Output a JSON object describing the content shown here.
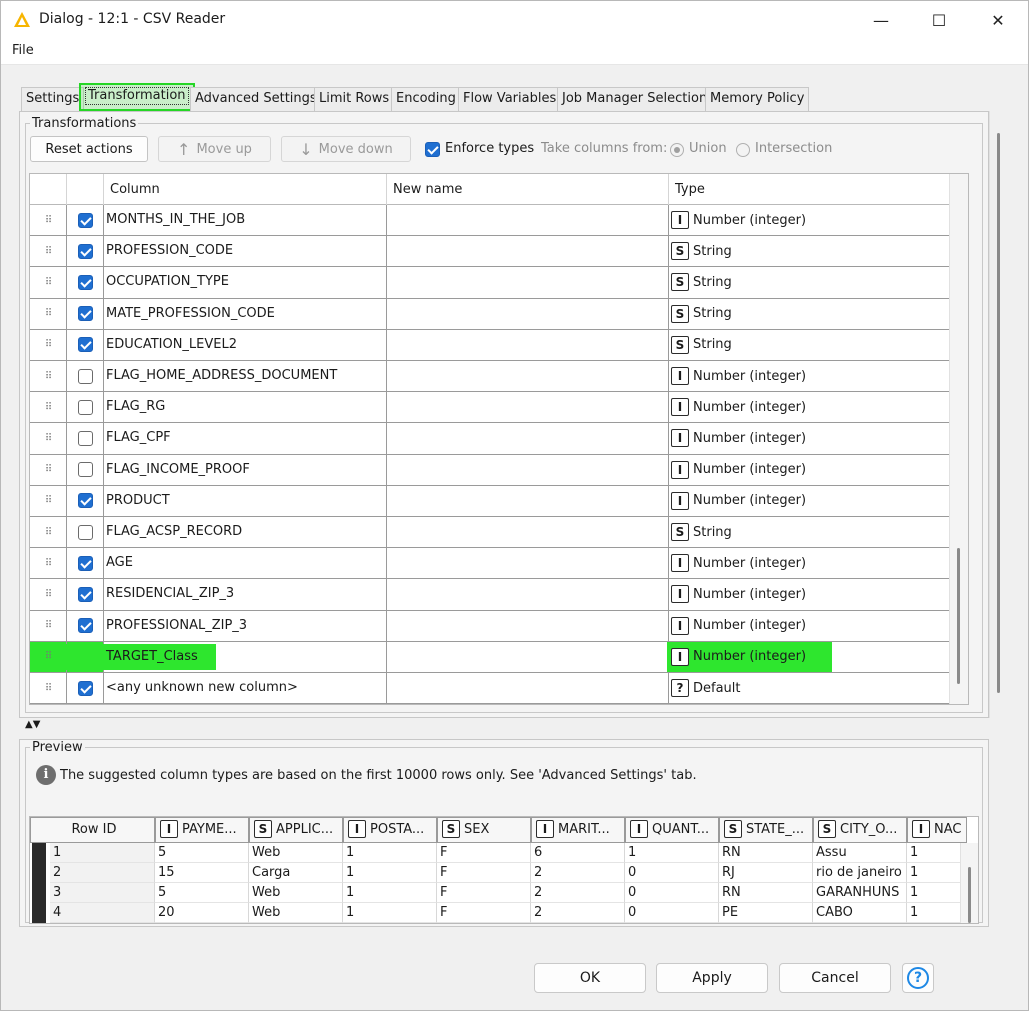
{
  "window": {
    "title": "Dialog - 12:1 - CSV Reader",
    "minimize_glyph": "—",
    "maximize_glyph": "☐",
    "close_glyph": "✕"
  },
  "menu": {
    "file": "File"
  },
  "tabs": [
    {
      "label": "Settings",
      "active": false
    },
    {
      "label": "Transformation",
      "active": true
    },
    {
      "label": "Advanced Settings",
      "active": false
    },
    {
      "label": "Limit Rows",
      "active": false
    },
    {
      "label": "Encoding",
      "active": false
    },
    {
      "label": "Flow Variables",
      "active": false
    },
    {
      "label": "Job Manager Selection",
      "active": false
    },
    {
      "label": "Memory Policy",
      "active": false
    }
  ],
  "transformations": {
    "group_title": "Transformations",
    "reset_label": "Reset actions",
    "move_up_label": "Move up",
    "move_down_label": "Move down",
    "enforce_types_label": "Enforce types",
    "enforce_types_checked": true,
    "take_columns_label": "Take columns from:",
    "union_label": "Union",
    "intersection_label": "Intersection",
    "selected_source": "Union",
    "headers": {
      "column": "Column",
      "new_name": "New name",
      "type": "Type"
    },
    "rows": [
      {
        "checked": true,
        "column": "MONTHS_IN_THE_JOB",
        "new_name": "",
        "type_icon": "I",
        "type": "Number (integer)"
      },
      {
        "checked": true,
        "column": "PROFESSION_CODE",
        "new_name": "",
        "type_icon": "S",
        "type": "String"
      },
      {
        "checked": true,
        "column": "OCCUPATION_TYPE",
        "new_name": "",
        "type_icon": "S",
        "type": "String"
      },
      {
        "checked": true,
        "column": "MATE_PROFESSION_CODE",
        "new_name": "",
        "type_icon": "S",
        "type": "String"
      },
      {
        "checked": true,
        "column": "EDUCATION_LEVEL2",
        "new_name": "",
        "type_icon": "S",
        "type": "String"
      },
      {
        "checked": false,
        "column": "FLAG_HOME_ADDRESS_DOCUMENT",
        "new_name": "",
        "type_icon": "I",
        "type": "Number (integer)"
      },
      {
        "checked": false,
        "column": "FLAG_RG",
        "new_name": "",
        "type_icon": "I",
        "type": "Number (integer)"
      },
      {
        "checked": false,
        "column": "FLAG_CPF",
        "new_name": "",
        "type_icon": "I",
        "type": "Number (integer)"
      },
      {
        "checked": false,
        "column": "FLAG_INCOME_PROOF",
        "new_name": "",
        "type_icon": "I",
        "type": "Number (integer)"
      },
      {
        "checked": true,
        "column": "PRODUCT",
        "new_name": "",
        "type_icon": "I",
        "type": "Number (integer)"
      },
      {
        "checked": false,
        "column": "FLAG_ACSP_RECORD",
        "new_name": "",
        "type_icon": "S",
        "type": "String"
      },
      {
        "checked": true,
        "column": "AGE",
        "new_name": "",
        "type_icon": "I",
        "type": "Number (integer)"
      },
      {
        "checked": true,
        "column": "RESIDENCIAL_ZIP_3",
        "new_name": "",
        "type_icon": "I",
        "type": "Number (integer)"
      },
      {
        "checked": true,
        "column": "PROFESSIONAL_ZIP_3",
        "new_name": "",
        "type_icon": "I",
        "type": "Number (integer)"
      },
      {
        "checked": true,
        "column": "TARGET_Class",
        "new_name": "",
        "type_icon": "I",
        "type": "Number (integer)",
        "highlighted": true
      },
      {
        "checked": true,
        "column": "<any unknown new column>",
        "new_name": "",
        "type_icon": "?",
        "type": "Default"
      }
    ]
  },
  "preview": {
    "group_title": "Preview",
    "info": "The suggested column types are based on the first 10000 rows only. See 'Advanced Settings' tab.",
    "columns": [
      {
        "icon": "",
        "label": "Row ID"
      },
      {
        "icon": "I",
        "label": "PAYME..."
      },
      {
        "icon": "S",
        "label": "APPLIC..."
      },
      {
        "icon": "I",
        "label": "POSTA..."
      },
      {
        "icon": "S",
        "label": "SEX"
      },
      {
        "icon": "I",
        "label": "MARIT..."
      },
      {
        "icon": "I",
        "label": "QUANT..."
      },
      {
        "icon": "S",
        "label": "STATE_..."
      },
      {
        "icon": "S",
        "label": "CITY_O..."
      },
      {
        "icon": "I",
        "label": "NAC"
      }
    ],
    "rows": [
      [
        "1",
        "5",
        "Web",
        "1",
        "F",
        "6",
        "1",
        "RN",
        "Assu",
        "1"
      ],
      [
        "2",
        "15",
        "Carga",
        "1",
        "F",
        "2",
        "0",
        "RJ",
        "rio de janeiro",
        "1"
      ],
      [
        "3",
        "5",
        "Web",
        "1",
        "F",
        "2",
        "0",
        "RN",
        "GARANHUNS",
        "1"
      ],
      [
        "4",
        "20",
        "Web",
        "1",
        "F",
        "2",
        "0",
        "PE",
        "CABO",
        "1"
      ]
    ]
  },
  "footer": {
    "ok": "OK",
    "apply": "Apply",
    "cancel": "Cancel",
    "help": "?"
  },
  "colors": {
    "highlight": "#2ee62e",
    "checkbox": "#1f6fd1",
    "help": "#1e88e5"
  }
}
